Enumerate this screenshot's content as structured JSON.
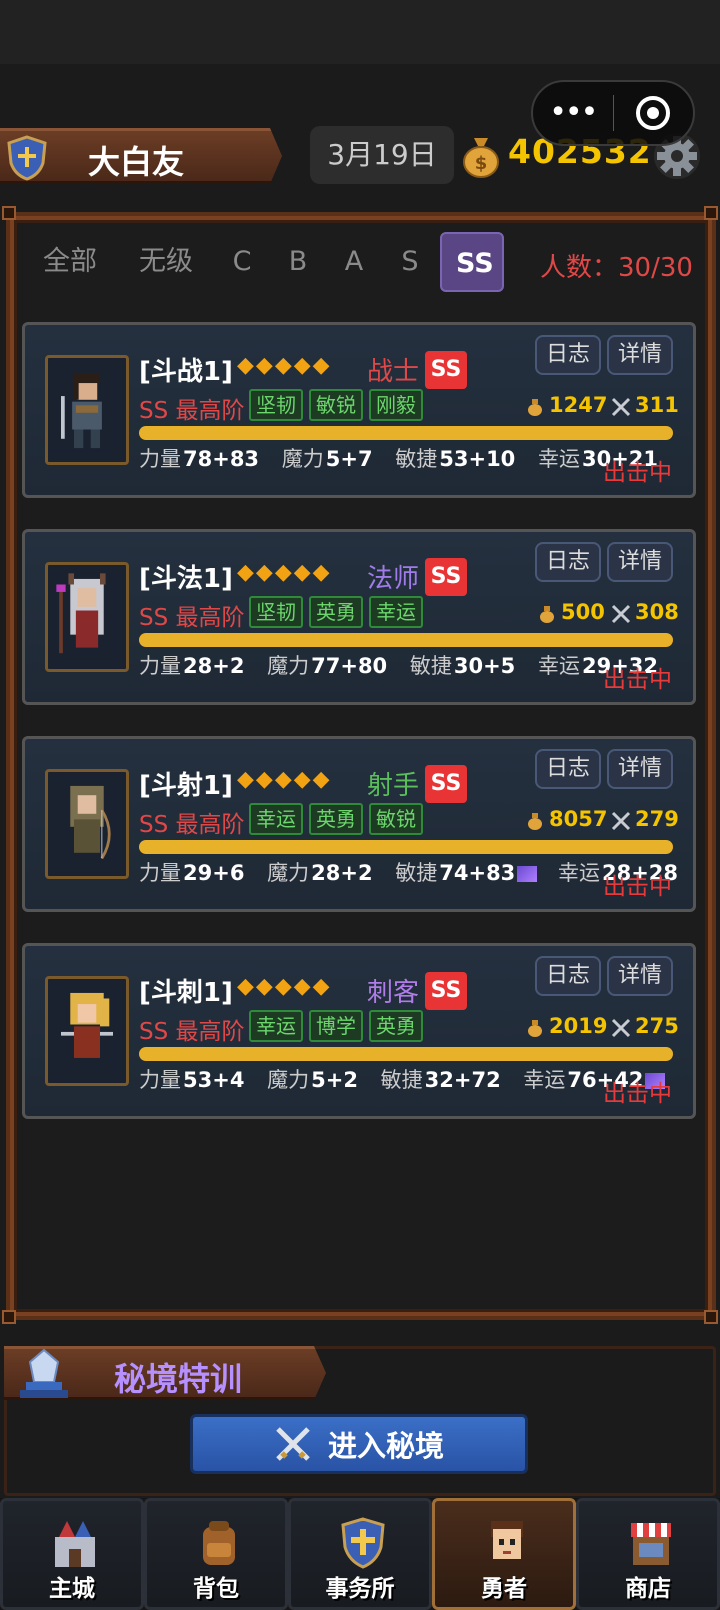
{
  "header": {
    "player_name": "大白友",
    "date": "3月19日",
    "gold": "402532",
    "menu_more": "•••"
  },
  "tabs": {
    "items": [
      "全部",
      "无级",
      "C",
      "B",
      "A",
      "S",
      "SS"
    ],
    "active": "SS",
    "count_label": "人数：30/30"
  },
  "heroes": [
    {
      "name": "[斗战1]",
      "stars": "◆◆◆◆◆",
      "class": "战士",
      "class_color": "#e04848",
      "rank": "SS",
      "tier": "SS 最高阶",
      "traits": [
        "坚韧",
        "敏锐",
        "刚毅"
      ],
      "gold": "1247",
      "power": "311",
      "stats": {
        "str": "78+83",
        "mag": "5+7",
        "agi": "53+10",
        "luck": "30+21"
      },
      "status": "出击中",
      "log_label": "日志",
      "detail_label": "详情"
    },
    {
      "name": "[斗法1]",
      "stars": "◆◆◆◆◆",
      "class": "法师",
      "class_color": "#a07ce8",
      "rank": "SS",
      "tier": "SS 最高阶",
      "traits": [
        "坚韧",
        "英勇",
        "幸运"
      ],
      "gold": "500",
      "power": "308",
      "stats": {
        "str": "28+2",
        "mag": "77+80",
        "agi": "30+5",
        "luck": "29+32"
      },
      "status": "出击中",
      "log_label": "日志",
      "detail_label": "详情"
    },
    {
      "name": "[斗射1]",
      "stars": "◆◆◆◆◆",
      "class": "射手",
      "class_color": "#5bbf5b",
      "rank": "SS",
      "tier": "SS 最高阶",
      "traits": [
        "幸运",
        "英勇",
        "敏锐"
      ],
      "gold": "8057",
      "power": "279",
      "stats": {
        "str": "29+6",
        "mag": "28+2",
        "agi": "74+83",
        "luck": "28+28"
      },
      "status": "出击中",
      "log_label": "日志",
      "detail_label": "详情"
    },
    {
      "name": "[斗刺1]",
      "stars": "◆◆◆◆◆",
      "class": "刺客",
      "class_color": "#b07ce8",
      "rank": "SS",
      "tier": "SS 最高阶",
      "traits": [
        "幸运",
        "博学",
        "英勇"
      ],
      "gold": "2019",
      "power": "275",
      "stats": {
        "str": "53+4",
        "mag": "5+2",
        "agi": "32+72",
        "luck": "76+42"
      },
      "status": "出击中",
      "log_label": "日志",
      "detail_label": "详情"
    }
  ],
  "stat_labels": {
    "str": "力量",
    "mag": "魔力",
    "agi": "敏捷",
    "luck": "幸运"
  },
  "secret": {
    "title": "秘境特训",
    "enter_label": "进入秘境"
  },
  "nav": [
    {
      "label": "主城",
      "icon": "castle-icon"
    },
    {
      "label": "背包",
      "icon": "backpack-icon"
    },
    {
      "label": "事务所",
      "icon": "shield-icon"
    },
    {
      "label": "勇者",
      "icon": "hero-face-icon",
      "active": true
    },
    {
      "label": "商店",
      "icon": "shop-icon"
    }
  ],
  "colors": {
    "gold_text": "#f5c400",
    "active_tab": "#5a4585",
    "rank_badge": "#e83434",
    "status_red": "#e83a3a",
    "trait_green": "#6cd66c"
  }
}
